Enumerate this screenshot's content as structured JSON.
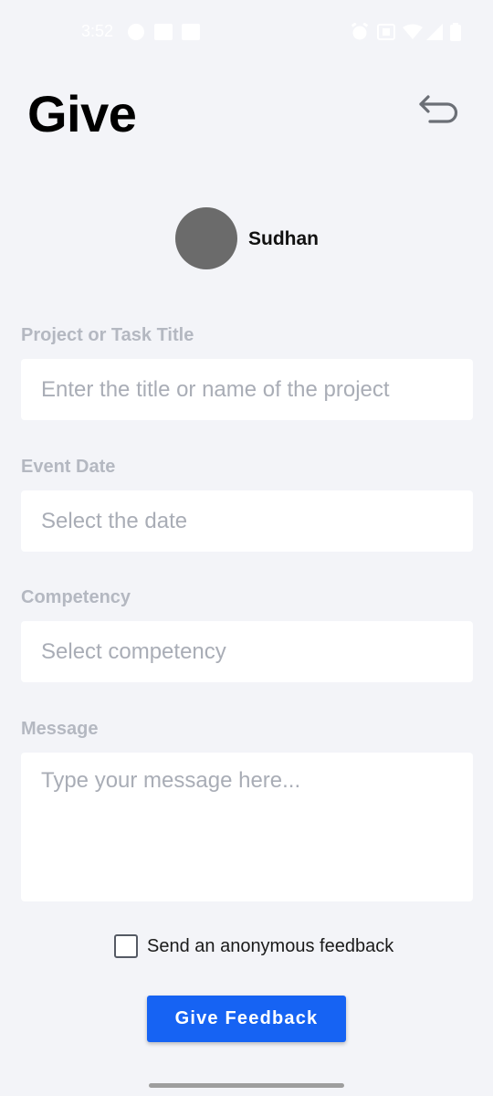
{
  "status_bar": {
    "time": "3:52",
    "left_icons": [
      "app-badge-icon",
      "image-icon",
      "image-icon"
    ],
    "right_icons": [
      "alarm-icon",
      "vibrate-icon",
      "wifi-icon",
      "signal-icon",
      "battery-icon"
    ]
  },
  "header": {
    "title": "Give",
    "back_icon": "return-arrow-icon"
  },
  "profile": {
    "name": "Sudhan"
  },
  "form": {
    "project": {
      "label": "Project or Task Title",
      "placeholder": "Enter the title or name of the project"
    },
    "date": {
      "label": "Event Date",
      "placeholder": "Select the date"
    },
    "competency": {
      "label": "Competency",
      "placeholder": "Select competency"
    },
    "message": {
      "label": "Message",
      "placeholder": "Type your message here..."
    },
    "anonymous": {
      "label": "Send an anonymous feedback",
      "checked": false
    },
    "submit_label": "Give Feedback"
  },
  "colors": {
    "background": "#f3f4f8",
    "accent": "#1663f3",
    "label": "#b4b8c1",
    "placeholder": "#a9adb6"
  }
}
